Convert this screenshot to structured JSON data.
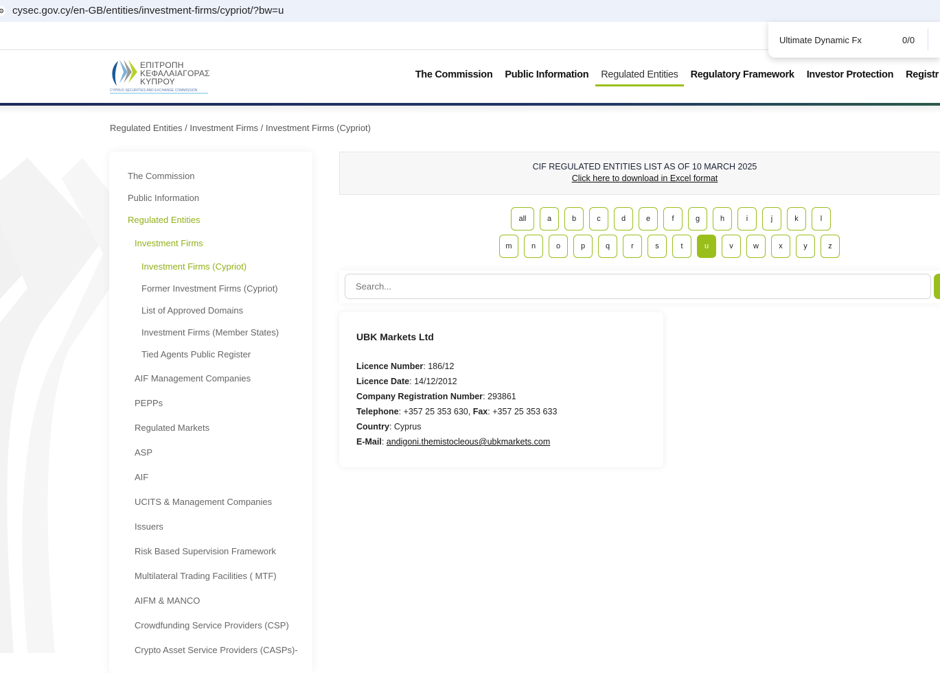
{
  "browser": {
    "url": "cysec.gov.cy/en-GB/entities/investment-firms/cypriot/?bw=u"
  },
  "popup": {
    "title": "Ultimate Dynamic Fx",
    "count": "0/0"
  },
  "logo": {
    "line1": "ΕΠΙΤΡΟΠΗ",
    "line2": "ΚΕΦΑΛΑΙΑΓΟΡΑΣ",
    "line3": "ΚΥΠΡΟΥ",
    "sub": "CYPRUS SECURITIES AND EXCHANGE COMMISSION"
  },
  "nav": [
    "The Commission",
    "Public Information",
    "Regulated Entities",
    "Regulatory Framework",
    "Investor Protection",
    "Registr"
  ],
  "breadcrumb": "Regulated Entities / Investment Firms / Investment Firms (Cypriot)",
  "sidebar": [
    {
      "label": "The Commission"
    },
    {
      "label": "Public Information"
    },
    {
      "label": "Regulated Entities"
    },
    {
      "label": "Investment Firms"
    },
    {
      "label": "Investment Firms (Cypriot)"
    },
    {
      "label": "Former Investment Firms (Cypriot)"
    },
    {
      "label": "List of Approved Domains"
    },
    {
      "label": "Investment Firms (Member States)"
    },
    {
      "label": "Tied Agents Public Register"
    },
    {
      "label": "AIF Management Companies"
    },
    {
      "label": "PEPPs"
    },
    {
      "label": "Regulated Markets"
    },
    {
      "label": "ASP"
    },
    {
      "label": "AIF"
    },
    {
      "label": "UCITS & Management Companies"
    },
    {
      "label": "Issuers"
    },
    {
      "label": "Risk Based Supervision Framework"
    },
    {
      "label": "Multilateral Trading Facilities ( MTF)"
    },
    {
      "label": "AIFM & MANCO"
    },
    {
      "label": "Crowdfunding Service Providers (CSP)"
    },
    {
      "label": "Crypto Asset Service Providers (CASPs)-"
    }
  ],
  "banner": {
    "heading": "CIF REGULATED ENTITIES LIST AS OF 10 MARCH 2025",
    "link": "Click here to download in Excel format"
  },
  "letters_row1": [
    "all",
    "a",
    "b",
    "c",
    "d",
    "e",
    "f",
    "g",
    "h",
    "i",
    "j",
    "k",
    "l"
  ],
  "letters_row2": [
    "m",
    "n",
    "o",
    "p",
    "q",
    "r",
    "s",
    "t",
    "u",
    "v",
    "w",
    "x",
    "y",
    "z"
  ],
  "selected_letter": "u",
  "search": {
    "placeholder": "Search..."
  },
  "entity": {
    "name": "UBK Markets Ltd",
    "licence_number_label": "Licence Number",
    "licence_number": "186/12",
    "licence_date_label": "Licence Date",
    "licence_date": "14/12/2012",
    "reg_label": "Company Registration Number",
    "reg": "293861",
    "tel_label": "Telephone",
    "tel": "+357 25 353 630",
    "fax_label": "Fax",
    "fax": "+357 25 353 633",
    "country_label": "Country",
    "country": "Cyprus",
    "email_label": "E-Mail",
    "email": "andigoni.themistocleous@ubkmarkets.com"
  },
  "colors": {
    "accent": "#9abf1c",
    "navy": "#1e2a5a"
  }
}
